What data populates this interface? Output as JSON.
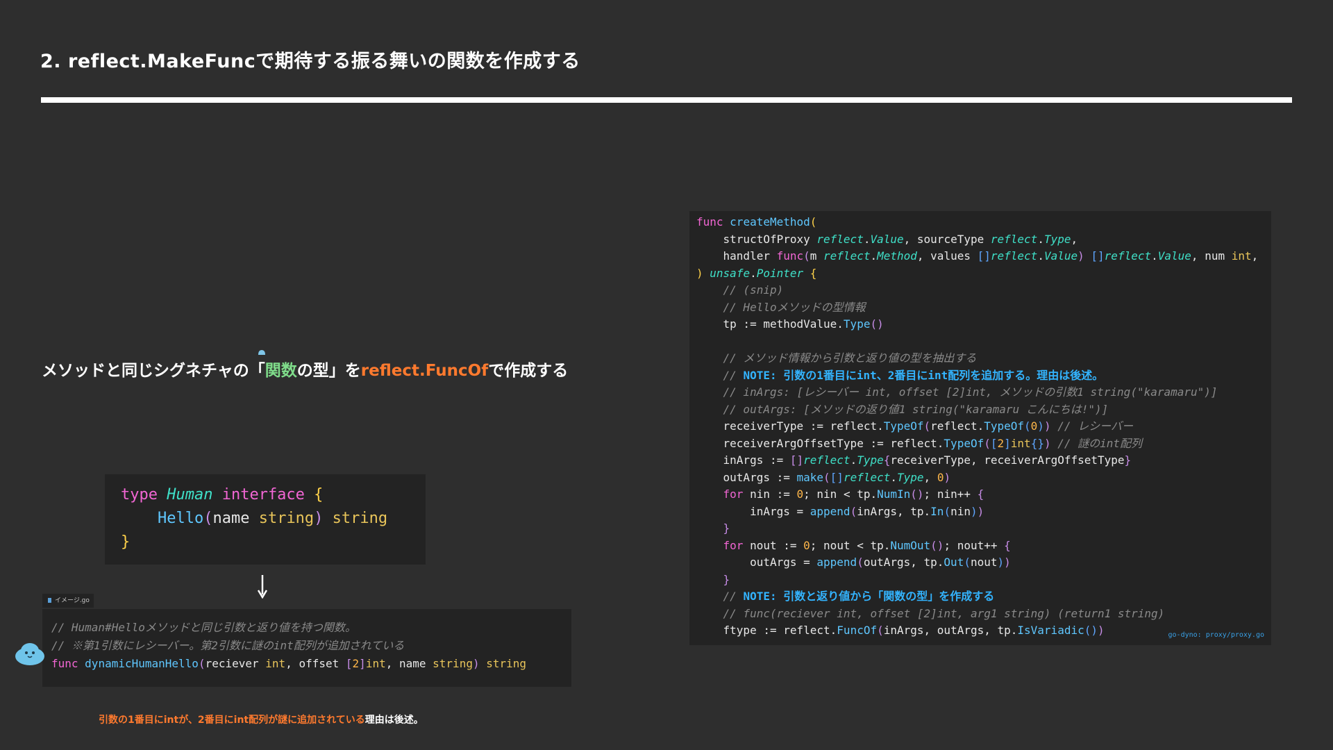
{
  "slide": {
    "title": "2. reflect.MakeFuncで期待する振る舞いの関数を作成する",
    "subtitle_parts": {
      "prefix": "メソッドと同じシグネチャの「",
      "highlight": "関数",
      "middle": "の型」を",
      "accent": "reflect.FuncOf",
      "suffix": "で作成する"
    },
    "note": {
      "highlight": "引数の1番目にintが、2番目にint配列が謎に追加されている",
      "tail": "理由は後述。"
    },
    "file_tab_label": "イメージ.go",
    "code_source": "go-dyno: proxy/proxy.go"
  },
  "interface_code": [
    [
      [
        "type ",
        "kw"
      ],
      [
        "Human",
        "ty"
      ],
      [
        " interface ",
        "kw"
      ],
      [
        "{",
        "br3"
      ]
    ],
    [
      [
        "    ",
        "pl"
      ],
      [
        "Hello",
        "fn"
      ],
      [
        "(",
        "br"
      ],
      [
        "name ",
        "pl"
      ],
      [
        "string",
        "tp"
      ],
      [
        ")",
        "br"
      ],
      [
        " string",
        "tp"
      ]
    ],
    [
      [
        "}",
        "br3"
      ]
    ]
  ],
  "dynamic_code": [
    [
      [
        "// Human#Helloメソッドと同じ引数と返り値を持つ関数。",
        "cm"
      ]
    ],
    [
      [
        "// ※第1引数にレシーバー。第2引数に謎のint配列が追加されている",
        "cm"
      ]
    ],
    [
      [
        "func ",
        "kw"
      ],
      [
        "dynamicHumanHello",
        "fn"
      ],
      [
        "(",
        "br"
      ],
      [
        "reciever ",
        "pl"
      ],
      [
        "int",
        "tp"
      ],
      [
        ", offset ",
        "pl"
      ],
      [
        "[",
        "br"
      ],
      [
        "2",
        "nu"
      ],
      [
        "]",
        "br"
      ],
      [
        "int",
        "tp"
      ],
      [
        ", name ",
        "pl"
      ],
      [
        "string",
        "tp"
      ],
      [
        ")",
        "br"
      ],
      [
        " string",
        "tp"
      ]
    ]
  ],
  "main_code": [
    [
      [
        "func ",
        "kw"
      ],
      [
        "createMethod",
        "fn"
      ],
      [
        "(",
        "br3"
      ]
    ],
    [
      [
        "    structOfProxy ",
        "pl"
      ],
      [
        "reflect",
        "ty"
      ],
      [
        ".",
        "pl"
      ],
      [
        "Value",
        "ty"
      ],
      [
        ", sourceType ",
        "pl"
      ],
      [
        "reflect",
        "ty"
      ],
      [
        ".",
        "pl"
      ],
      [
        "Type",
        "ty"
      ],
      [
        ",",
        "pl"
      ]
    ],
    [
      [
        "    handler ",
        "pl"
      ],
      [
        "func",
        "kw"
      ],
      [
        "(",
        "br"
      ],
      [
        "m ",
        "pl"
      ],
      [
        "reflect",
        "ty"
      ],
      [
        ".",
        "pl"
      ],
      [
        "Method",
        "ty"
      ],
      [
        ", values ",
        "pl"
      ],
      [
        "[]",
        "br2"
      ],
      [
        "reflect",
        "ty"
      ],
      [
        ".",
        "pl"
      ],
      [
        "Value",
        "ty"
      ],
      [
        ")",
        "br"
      ],
      [
        " ",
        "pl"
      ],
      [
        "[]",
        "br2"
      ],
      [
        "reflect",
        "ty"
      ],
      [
        ".",
        "pl"
      ],
      [
        "Value",
        "ty"
      ],
      [
        ", num ",
        "pl"
      ],
      [
        "int",
        "tp"
      ],
      [
        ",",
        "pl"
      ]
    ],
    [
      [
        ")",
        "br3"
      ],
      [
        " ",
        "pl"
      ],
      [
        "unsafe",
        "ty"
      ],
      [
        ".",
        "pl"
      ],
      [
        "Pointer",
        "ty"
      ],
      [
        " {",
        "br3"
      ]
    ],
    [
      [
        "    // (snip)",
        "cm"
      ]
    ],
    [
      [
        "    // Helloメソッドの型情報",
        "cm"
      ]
    ],
    [
      [
        "    tp := methodValue.",
        "pl"
      ],
      [
        "Type",
        "fn"
      ],
      [
        "()",
        "br"
      ]
    ],
    [],
    [
      [
        "    // メソッド情報から引数と返り値の型を抽出する",
        "cm"
      ]
    ],
    [
      [
        "    // ",
        "cm"
      ],
      [
        "NOTE: 引数の1番目にint、2番目にint配列を追加する。理由は後述。",
        "nt"
      ]
    ],
    [
      [
        "    // inArgs: [レシーバー int, offset [2]int, メソッドの引数1 string(\"karamaru\")]",
        "cm"
      ]
    ],
    [
      [
        "    // outArgs: [メソッドの返り値1 string(\"karamaru こんにちは!\")]",
        "cm"
      ]
    ],
    [
      [
        "    receiverType := reflect.",
        "pl"
      ],
      [
        "TypeOf",
        "fn"
      ],
      [
        "(",
        "br"
      ],
      [
        "reflect.",
        "pl"
      ],
      [
        "TypeOf",
        "fn"
      ],
      [
        "(",
        "br2"
      ],
      [
        "0",
        "nu"
      ],
      [
        ")",
        "br2"
      ],
      [
        ")",
        "br"
      ],
      [
        " // レシーバー",
        "cm"
      ]
    ],
    [
      [
        "    receiverArgOffsetType := reflect.",
        "pl"
      ],
      [
        "TypeOf",
        "fn"
      ],
      [
        "(",
        "br"
      ],
      [
        "[",
        "br2"
      ],
      [
        "2",
        "nu"
      ],
      [
        "]",
        "br2"
      ],
      [
        "int",
        "tp"
      ],
      [
        "{}",
        "br2"
      ],
      [
        ")",
        "br"
      ],
      [
        " // 謎のint配列",
        "cm"
      ]
    ],
    [
      [
        "    inArgs := ",
        "pl"
      ],
      [
        "[]",
        "br"
      ],
      [
        "reflect",
        "ty"
      ],
      [
        ".",
        "pl"
      ],
      [
        "Type",
        "ty"
      ],
      [
        "{",
        "br"
      ],
      [
        "receiverType, receiverArgOffsetType",
        "pl"
      ],
      [
        "}",
        "br"
      ]
    ],
    [
      [
        "    outArgs := ",
        "pl"
      ],
      [
        "make",
        "fn"
      ],
      [
        "(",
        "br"
      ],
      [
        "[]",
        "br2"
      ],
      [
        "reflect",
        "ty"
      ],
      [
        ".",
        "pl"
      ],
      [
        "Type",
        "ty"
      ],
      [
        ", ",
        "pl"
      ],
      [
        "0",
        "nu"
      ],
      [
        ")",
        "br"
      ]
    ],
    [
      [
        "    ",
        "pl"
      ],
      [
        "for",
        "kw"
      ],
      [
        " nin := ",
        "pl"
      ],
      [
        "0",
        "nu"
      ],
      [
        "; nin < tp.",
        "pl"
      ],
      [
        "NumIn",
        "fn"
      ],
      [
        "()",
        "br"
      ],
      [
        "; nin++ ",
        "pl"
      ],
      [
        "{",
        "br"
      ]
    ],
    [
      [
        "        inArgs = ",
        "pl"
      ],
      [
        "append",
        "fn"
      ],
      [
        "(",
        "br"
      ],
      [
        "inArgs, tp.",
        "pl"
      ],
      [
        "In",
        "fn"
      ],
      [
        "(",
        "br2"
      ],
      [
        "nin",
        "pl"
      ],
      [
        ")",
        "br2"
      ],
      [
        ")",
        "br"
      ]
    ],
    [
      [
        "    ",
        "pl"
      ],
      [
        "}",
        "br"
      ]
    ],
    [
      [
        "    ",
        "pl"
      ],
      [
        "for",
        "kw"
      ],
      [
        " nout := ",
        "pl"
      ],
      [
        "0",
        "nu"
      ],
      [
        "; nout < tp.",
        "pl"
      ],
      [
        "NumOut",
        "fn"
      ],
      [
        "()",
        "br"
      ],
      [
        "; nout++ ",
        "pl"
      ],
      [
        "{",
        "br"
      ]
    ],
    [
      [
        "        outArgs = ",
        "pl"
      ],
      [
        "append",
        "fn"
      ],
      [
        "(",
        "br"
      ],
      [
        "outArgs, tp.",
        "pl"
      ],
      [
        "Out",
        "fn"
      ],
      [
        "(",
        "br2"
      ],
      [
        "nout",
        "pl"
      ],
      [
        ")",
        "br2"
      ],
      [
        ")",
        "br"
      ]
    ],
    [
      [
        "    ",
        "pl"
      ],
      [
        "}",
        "br"
      ]
    ],
    [
      [
        "    // ",
        "cm"
      ],
      [
        "NOTE: 引数と返り値から「関数の型」を作成する",
        "nt"
      ]
    ],
    [
      [
        "    // func(reciever int, offset [2]int, arg1 string) (return1 string)",
        "cm"
      ]
    ],
    [
      [
        "    ftype := reflect.",
        "pl"
      ],
      [
        "FuncOf",
        "fn"
      ],
      [
        "(",
        "br"
      ],
      [
        "inArgs, outArgs, tp.",
        "pl"
      ],
      [
        "IsVariadic",
        "fn"
      ],
      [
        "()",
        "br2"
      ],
      [
        ")",
        "br"
      ]
    ]
  ]
}
